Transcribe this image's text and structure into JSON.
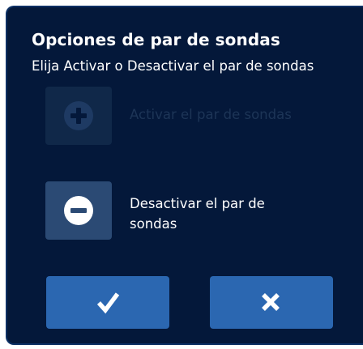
{
  "dialog": {
    "title": "Opciones de par de sondas",
    "subtitle": "Elija Activar o Desactivar el par de sondas",
    "colors": {
      "background": "#04183a",
      "border": "#0b2f63",
      "button_accent": "#2b67b1",
      "option_button": "#2b4a74",
      "disabled_text": "#1d3557"
    }
  },
  "options": {
    "activate": {
      "label": "Activar el par de sondas",
      "icon": "plus-circle-icon",
      "enabled": false
    },
    "deactivate": {
      "label": "Desactivar el par de sondas",
      "icon": "minus-circle-icon",
      "enabled": true
    }
  },
  "actions": {
    "confirm_icon": "checkmark-icon",
    "cancel_icon": "close-icon"
  }
}
